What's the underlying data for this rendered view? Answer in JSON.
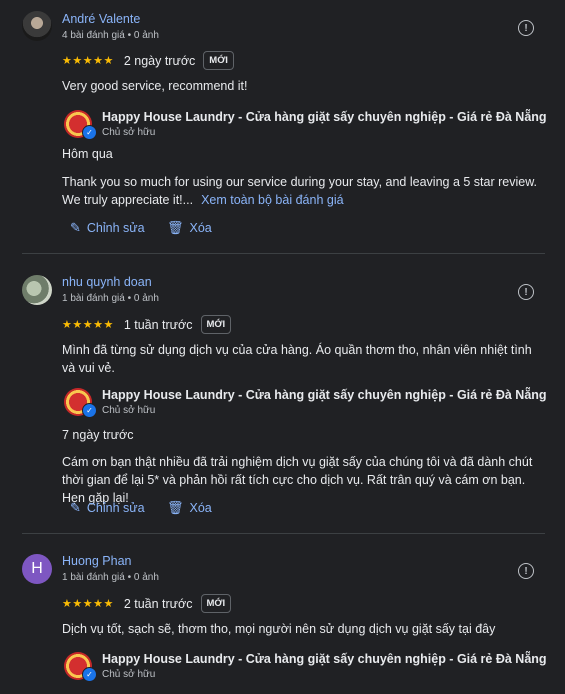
{
  "reviews": [
    {
      "name": "André Valente",
      "meta": "4 bài đánh giá • 0 ảnh",
      "stars": "★★★★★",
      "when": "2 ngày trước",
      "badge": "MỚI",
      "text": "Very good service, recommend it!",
      "reply": {
        "owner_name": "Happy House Laundry - Cửa hàng giặt sấy chuyên nghiệp - Giá rẻ Đà Nẵng",
        "owner_role": "Chủ sở hữu",
        "when": "Hôm qua",
        "text": "Thank you so much for using our service during your stay, and leaving a 5 star review. We truly appreciate it!...",
        "more": "Xem toàn bộ bài đánh giá"
      },
      "edit_label": "Chỉnh sửa",
      "delete_label": "Xóa"
    },
    {
      "name": "nhu quynh doan",
      "meta": "1 bài đánh giá • 0 ảnh",
      "stars": "★★★★★",
      "when": "1 tuần trước",
      "badge": "MỚI",
      "text": "Mình đã từng sử dụng dịch vụ của cửa hàng. Áo quần thơm tho, nhân viên nhiệt tình và vui vẻ.",
      "reply": {
        "owner_name": "Happy House Laundry - Cửa hàng giặt sấy chuyên nghiệp - Giá rẻ Đà Nẵng",
        "owner_role": "Chủ sở hữu",
        "when": "7 ngày trước",
        "text": "Cám ơn bạn thật nhiều đã trải nghiệm dịch vụ giặt sấy của chúng tôi và đã dành chút thời gian để lại 5* và phản hồi rất tích cực cho dịch vụ. Rất trân quý và cám ơn bạn. Hẹn gặp lại!"
      },
      "edit_label": "Chỉnh sửa",
      "delete_label": "Xóa"
    },
    {
      "name": "Huong Phan",
      "avatar_letter": "H",
      "meta": "1 bài đánh giá • 0 ảnh",
      "stars": "★★★★★",
      "when": "2 tuần trước",
      "badge": "MỚI",
      "text": "Dịch vụ tốt, sạch sẽ, thơm tho, mọi người nên sử dụng dịch vụ giặt sấy tại đây",
      "reply": {
        "owner_name": "Happy House Laundry - Cửa hàng giặt sấy chuyên nghiệp - Giá rẻ Đà Nẵng",
        "owner_role": "Chủ sở hữu"
      }
    }
  ],
  "icons": {
    "flag": "report-flag-icon",
    "edit": "pencil-icon",
    "delete": "trash-icon"
  },
  "colors": {
    "background": "#202124",
    "link": "#8ab4f8",
    "star": "#fbbc04",
    "avatar_letter_bg": "#7e57c2"
  }
}
